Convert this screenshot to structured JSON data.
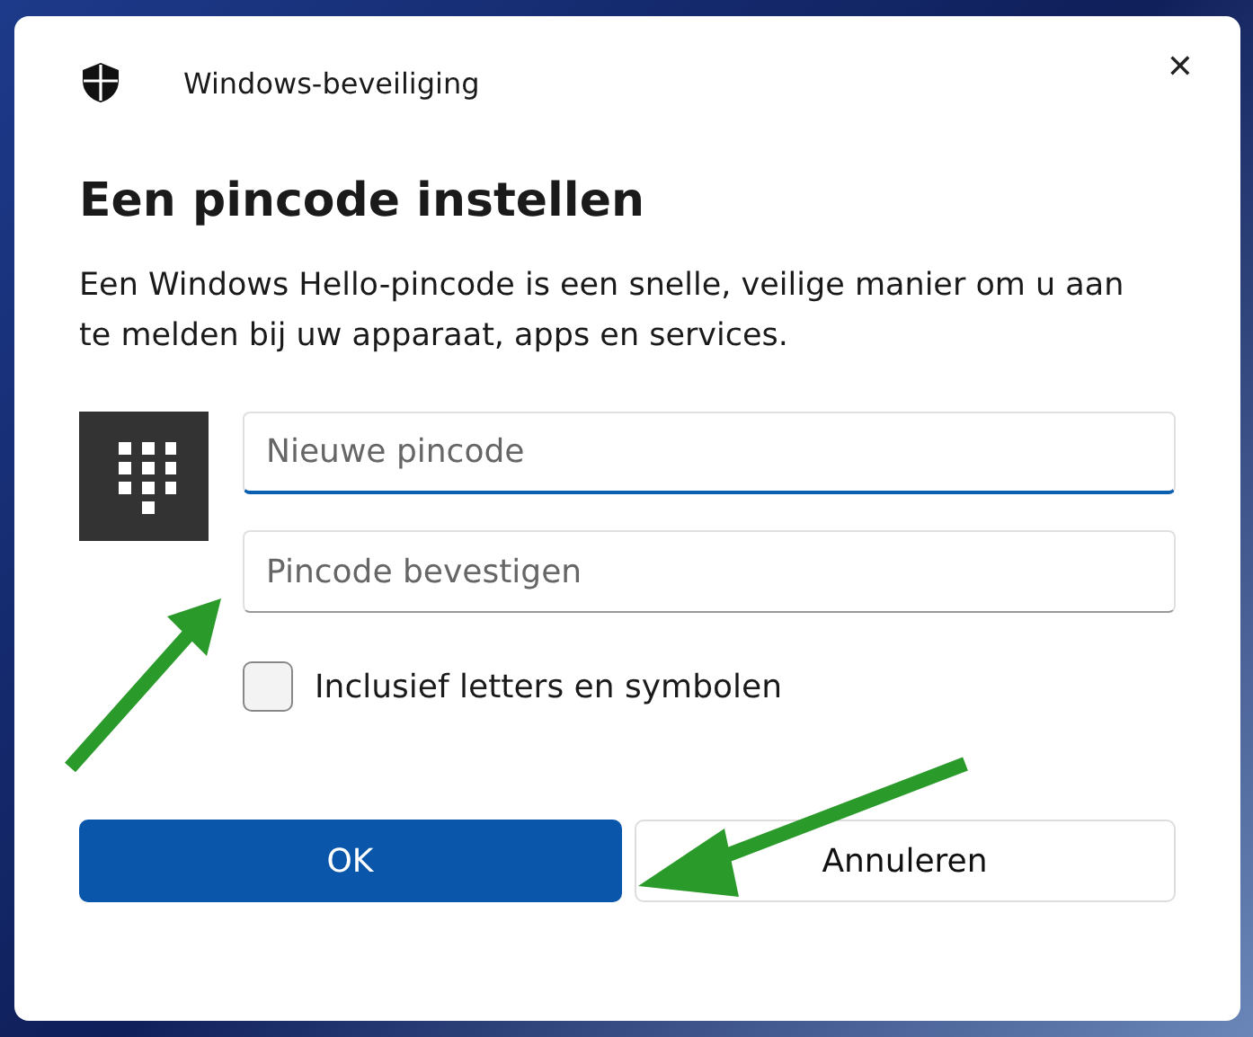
{
  "window": {
    "title": "Windows-beveiliging",
    "close": "✕"
  },
  "heading": "Een pincode instellen",
  "description": "Een Windows Hello-pincode is een snelle, veilige manier om u aan te melden bij uw apparaat, apps en services.",
  "fields": [
    {
      "placeholder": "Nieuwe pincode",
      "focused": true
    },
    {
      "placeholder": "Pincode bevestigen",
      "focused": false
    }
  ],
  "checkbox": {
    "label": "Inclusief letters en symbolen",
    "checked": false
  },
  "buttons": [
    {
      "label": "OK",
      "kind": "primary"
    },
    {
      "label": "Annuleren",
      "kind": "secondary"
    }
  ],
  "annotations": [
    {
      "kind": "arrow"
    },
    {
      "kind": "arrow"
    }
  ]
}
